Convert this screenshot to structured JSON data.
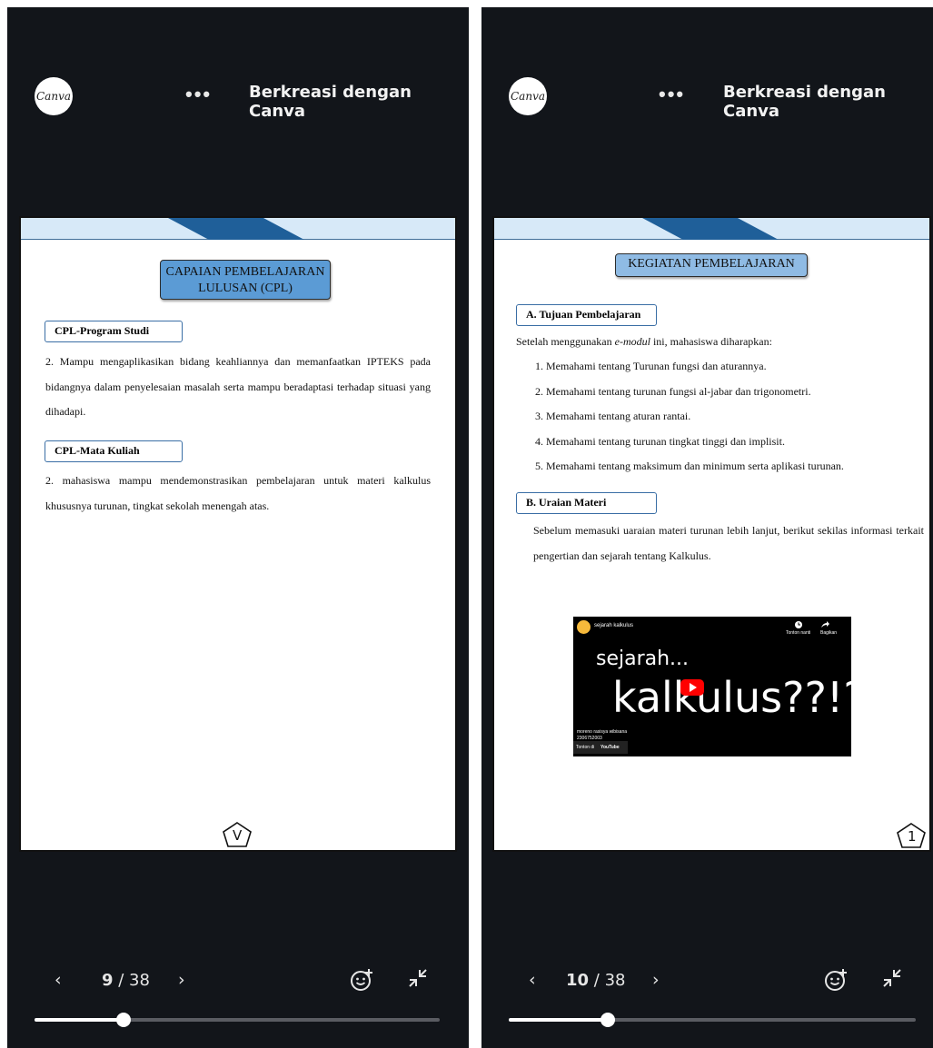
{
  "viewers": [
    {
      "logo_text": "Canva",
      "menu_dots": "•••",
      "brand": "Berkreasi dengan Canva",
      "page": {
        "title_line1": "CAPAIAN PEMBELAJARAN",
        "title_line2": "LULUSAN (CPL)",
        "section1_label": "CPL-Program Studi",
        "section1_text": "2. Mampu mengaplikasikan bidang keahliannya dan memanfaatkan IPTEKS pada bidangnya dalam penyelesaian masalah serta mampu beradaptasi terhadap situasi yang dihadapi.",
        "section2_label": "CPL-Mata Kuliah",
        "section2_text": "2. mahasiswa mampu mendemonstrasikan pembelajaran untuk materi kalkulus khususnya turunan, tingkat sekolah menengah atas.",
        "page_number": "V"
      },
      "nav": {
        "prev": "‹",
        "current": "9",
        "separator": " / ",
        "total": "38",
        "next": "›",
        "progress_fraction": 0.22
      },
      "icons": [
        "chevron-left-icon",
        "chevron-right-icon",
        "add-reaction-icon",
        "exit-fullscreen-icon"
      ]
    },
    {
      "logo_text": "Canva",
      "menu_dots": "•••",
      "brand": "Berkreasi dengan Canva",
      "page": {
        "title": "KEGIATAN PEMBELAJARAN",
        "sectionA_label": "A. Tujuan Pembelajaran",
        "intro_prefix": "Setelah menggunakan ",
        "intro_italic": "e-modul",
        "intro_suffix": " ini, mahasiswa diharapkan:",
        "objectives": [
          "1.  Memahami tentang Turunan fungsi dan aturannya.",
          "2.  Memahami tentang turunan fungsi al-jabar dan trigonometri.",
          "3.  Memahami tentang aturan rantai.",
          "4.  Memahami tentang turunan tingkat tinggi dan implisit.",
          "5.  Memahami tentang maksimum dan minimum serta aplikasi turunan."
        ],
        "sectionB_label": "B. Uraian Materi",
        "sectionB_text": "Sebelum memasuki uaraian materi turunan lebih lanjut, berikut sekilas informasi terkait pengertian dan sejarah tentang Kalkulus.",
        "video": {
          "channel_title": "sejarah kalkulus",
          "watch_later": "Tonton nanti",
          "share": "Bagikan",
          "big_line1": "sejarah...",
          "big_line2": "kalkulus??!?",
          "author": "moreno rasisya wibisana",
          "author_id": "2306752003",
          "watch_on": "Tonton di",
          "youtube": "YouTube"
        },
        "page_number": "1"
      },
      "nav": {
        "prev": "‹",
        "current": "10",
        "separator": " / ",
        "total": "38",
        "next": "›",
        "progress_fraction": 0.24
      },
      "icons": [
        "chevron-left-icon",
        "chevron-right-icon",
        "add-reaction-icon",
        "exit-fullscreen-icon"
      ]
    }
  ],
  "colors": {
    "background": "#12151a",
    "title_box": "#5b9bd5",
    "band": "#d7e9f8",
    "band_accent": "#1f5f99",
    "youtube_red": "#ff0000"
  }
}
